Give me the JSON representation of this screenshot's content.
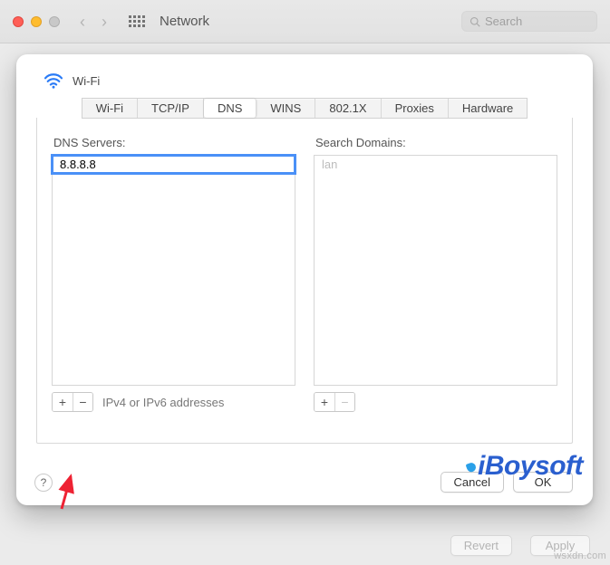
{
  "window": {
    "title": "Network",
    "search_placeholder": "Search"
  },
  "sheet": {
    "connection_name": "Wi-Fi",
    "tabs": [
      "Wi-Fi",
      "TCP/IP",
      "DNS",
      "WINS",
      "802.1X",
      "Proxies",
      "Hardware"
    ],
    "active_tab_index": 2,
    "dns": {
      "label": "DNS Servers:",
      "entries": [
        "8.8.8.8"
      ],
      "editing_index": 0,
      "hint": "IPv4 or IPv6 addresses"
    },
    "search_domains": {
      "label": "Search Domains:",
      "entries": [],
      "placeholder": "lan"
    },
    "buttons": {
      "help": "?",
      "cancel": "Cancel",
      "ok": "OK",
      "add": "+",
      "remove": "−"
    }
  },
  "window_footer": {
    "revert": "Revert",
    "apply": "Apply"
  },
  "watermarks": {
    "brand": "iBoysoft",
    "source": "wsxdn.com"
  }
}
